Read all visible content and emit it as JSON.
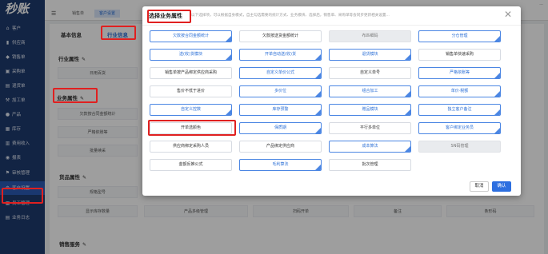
{
  "sidebar": {
    "logo": "秒账",
    "items": [
      {
        "icon": "home-icon",
        "glyph": "⌂",
        "label": "客户"
      },
      {
        "icon": "supplier-icon",
        "glyph": "▮",
        "label": "供应商"
      },
      {
        "icon": "sales-icon",
        "glyph": "◆",
        "label": "销售单"
      },
      {
        "icon": "purchase-icon",
        "glyph": "▣",
        "label": "采购单"
      },
      {
        "icon": "return-icon",
        "glyph": "▤",
        "label": "退货单"
      },
      {
        "icon": "process-icon",
        "glyph": "⚒",
        "label": "加工单"
      },
      {
        "icon": "product-icon",
        "glyph": "●",
        "label": "产品"
      },
      {
        "icon": "stock-icon",
        "glyph": "▦",
        "label": "库存"
      },
      {
        "icon": "income-icon",
        "glyph": "▥",
        "label": "费用收入"
      },
      {
        "icon": "report-icon",
        "glyph": "◉",
        "label": "报表"
      },
      {
        "icon": "approval-icon",
        "glyph": "⚑",
        "label": "审核管理"
      },
      {
        "icon": "settings-icon",
        "glyph": "⚙",
        "label": "客户设置"
      },
      {
        "icon": "staff-icon",
        "glyph": "▦",
        "label": "员工管理"
      },
      {
        "icon": "log-icon",
        "glyph": "▤",
        "label": "业务日志"
      }
    ]
  },
  "topbar": {
    "tabs": [
      "销售单",
      "客户设置"
    ],
    "right_text": "..."
  },
  "content": {
    "tab_basic": "基本信息",
    "tab_industry": "行业信息",
    "section_industry": "行业属性",
    "industry_value": "日用百货",
    "section_business": "业务属性",
    "business_cells": [
      "欠款按合同金额统计",
      "严格依账等",
      "批量续采"
    ],
    "section_product": "货品属性",
    "product_cells": [
      "规格型号",
      "显示库存数量",
      "产品多级管理",
      "扫码开单",
      "备注",
      "条形码"
    ],
    "section_sales": "销售服务"
  },
  "modal": {
    "title": "选择业务属性",
    "hint": "以下选择项，可以根据自身模式，自主勾选需要的统计方式、业务模块、选择后，销售单、采购单等会同步更新相关设置...",
    "options": [
      {
        "label": "欠款按合同金额统计",
        "state": "on"
      },
      {
        "label": "欠款按送货金额统计",
        "state": "off"
      },
      {
        "label": "布匹细码",
        "state": "dis"
      },
      {
        "label": "分仓管理",
        "state": "on"
      },
      {
        "label": "送(收)货模块",
        "state": "on"
      },
      {
        "label": "开单自动送(收)货",
        "state": "on"
      },
      {
        "label": "退货模块",
        "state": "on"
      },
      {
        "label": "销售单快速采购",
        "state": "off"
      },
      {
        "label": "销售单按产品绑定供应商采购",
        "state": "off"
      },
      {
        "label": "自定义单价公式",
        "state": "on"
      },
      {
        "label": "自定义单号",
        "state": "off"
      },
      {
        "label": "严格依账等",
        "state": "on"
      },
      {
        "label": "售价不低于进价",
        "state": "off"
      },
      {
        "label": "多价位",
        "state": "on"
      },
      {
        "label": "组合加工",
        "state": "on"
      },
      {
        "label": "单价·税额",
        "state": "on"
      },
      {
        "label": "自定义控数",
        "state": "on"
      },
      {
        "label": "库存预警",
        "state": "on"
      },
      {
        "label": "赠品模块",
        "state": "on"
      },
      {
        "label": "独立客户备注",
        "state": "on"
      },
      {
        "label": "开单选颜色",
        "state": "off"
      },
      {
        "label": "保质期",
        "state": "on"
      },
      {
        "label": "平行多单位",
        "state": "off"
      },
      {
        "label": "客户绑定业务员",
        "state": "on"
      },
      {
        "label": "供应商绑定采购人员",
        "state": "off"
      },
      {
        "label": "产品绑定供应商",
        "state": "off"
      },
      {
        "label": "成本算法",
        "state": "on"
      },
      {
        "label": "SN码管理",
        "state": "dis"
      },
      {
        "label": "金额反推公式",
        "state": "off"
      },
      {
        "label": "毛利算法",
        "state": "on"
      },
      {
        "label": "批次管理",
        "state": "off"
      }
    ],
    "cancel": "取消",
    "ok": "确认"
  }
}
